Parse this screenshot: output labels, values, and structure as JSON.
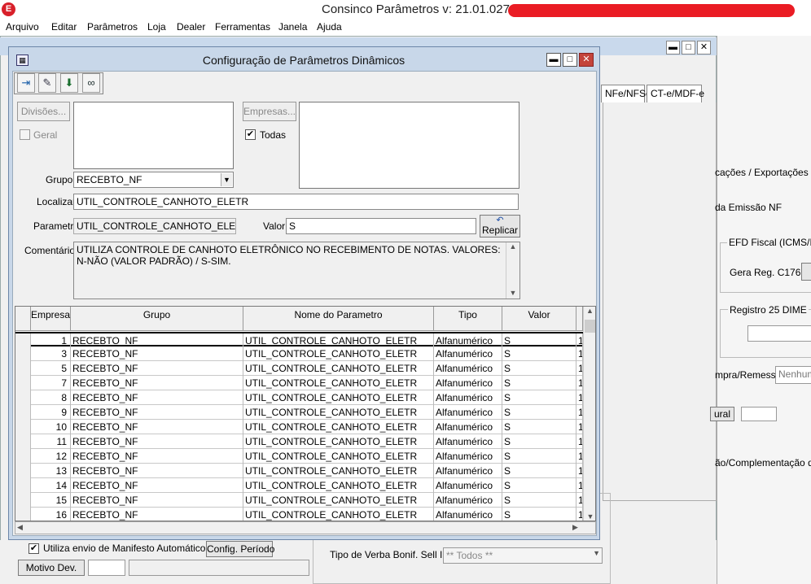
{
  "app": {
    "title": "Consinco Parâmetros  v: 21.01.027"
  },
  "menu": [
    "Arquivo",
    "Editar",
    "Parâmetros",
    "Loja",
    "Dealer",
    "Ferramentas",
    "Janela",
    "Ajuda"
  ],
  "background": {
    "tabs": [
      "NFe/NFSe",
      "CT-e/MDF-e"
    ],
    "labels": {
      "exportacoes": "cações / Exportações",
      "emissao_nf": "da Emissão NF",
      "efd_fiscal": "EFD Fiscal (ICMS/IPI",
      "gera_reg": "Gera Reg. C176",
      "registro25": "Registro 25 DIME",
      "compra_remessa": "mpra/Remessa",
      "nenhum": "Nenhum",
      "rural": "ural",
      "complementacao": "ão/Complementação de I",
      "utiliza_envio": "Utiliza envio de Manifesto Automático",
      "config_periodo": "Config. Período",
      "motivo_dev": "Motivo Dev.",
      "tipo_verba": "Tipo de Verba Bonif. Sell In",
      "tipo_verba_value": "** Todos **"
    }
  },
  "dialog": {
    "title": "Configuração de Parâmetros Dinâmicos",
    "toolbar_icons": [
      "exit-icon",
      "eraser-icon",
      "save-icon",
      "binoculars-icon"
    ],
    "divisoes_label": "Divisões...",
    "geral_label": "Geral",
    "empresas_label": "Empresas...",
    "todas_label": "Todas",
    "grupo_label": "Grupo",
    "grupo_value": "RECEBTO_NF",
    "localizar_label": "Localizar",
    "localizar_value": "UTIL_CONTROLE_CANHOTO_ELETR",
    "parametro_label": "Parametro",
    "parametro_value": "UTIL_CONTROLE_CANHOTO_ELETR",
    "valor_label": "Valor",
    "valor_value": "S",
    "replicar_label": "Replicar",
    "comentarios_label": "Comentários",
    "comentarios_value": "UTILIZA CONTROLE DE CANHOTO ELETRÔNICO NO RECEBIMENTO DE NOTAS. VALORES: N-NÃO (VALOR PADRÃO) / S-SIM."
  },
  "grid": {
    "columns": [
      "Empresa",
      "Grupo",
      "Nome do Parametro",
      "Tipo",
      "Valor"
    ],
    "rows": [
      {
        "empresa": "1",
        "grupo": "RECEBTO_NF",
        "nome": "UTIL_CONTROLE_CANHOTO_ELETR",
        "tipo": "Alfanumérico",
        "valor": "S",
        "extra": "1"
      },
      {
        "empresa": "3",
        "grupo": "RECEBTO_NF",
        "nome": "UTIL_CONTROLE_CANHOTO_ELETR",
        "tipo": "Alfanumérico",
        "valor": "S",
        "extra": "1"
      },
      {
        "empresa": "5",
        "grupo": "RECEBTO_NF",
        "nome": "UTIL_CONTROLE_CANHOTO_ELETR",
        "tipo": "Alfanumérico",
        "valor": "S",
        "extra": "1"
      },
      {
        "empresa": "7",
        "grupo": "RECEBTO_NF",
        "nome": "UTIL_CONTROLE_CANHOTO_ELETR",
        "tipo": "Alfanumérico",
        "valor": "S",
        "extra": "1"
      },
      {
        "empresa": "8",
        "grupo": "RECEBTO_NF",
        "nome": "UTIL_CONTROLE_CANHOTO_ELETR",
        "tipo": "Alfanumérico",
        "valor": "S",
        "extra": "1"
      },
      {
        "empresa": "9",
        "grupo": "RECEBTO_NF",
        "nome": "UTIL_CONTROLE_CANHOTO_ELETR",
        "tipo": "Alfanumérico",
        "valor": "S",
        "extra": "1"
      },
      {
        "empresa": "10",
        "grupo": "RECEBTO_NF",
        "nome": "UTIL_CONTROLE_CANHOTO_ELETR",
        "tipo": "Alfanumérico",
        "valor": "S",
        "extra": "1"
      },
      {
        "empresa": "11",
        "grupo": "RECEBTO_NF",
        "nome": "UTIL_CONTROLE_CANHOTO_ELETR",
        "tipo": "Alfanumérico",
        "valor": "S",
        "extra": "1"
      },
      {
        "empresa": "12",
        "grupo": "RECEBTO_NF",
        "nome": "UTIL_CONTROLE_CANHOTO_ELETR",
        "tipo": "Alfanumérico",
        "valor": "S",
        "extra": "1"
      },
      {
        "empresa": "13",
        "grupo": "RECEBTO_NF",
        "nome": "UTIL_CONTROLE_CANHOTO_ELETR",
        "tipo": "Alfanumérico",
        "valor": "S",
        "extra": "1"
      },
      {
        "empresa": "14",
        "grupo": "RECEBTO_NF",
        "nome": "UTIL_CONTROLE_CANHOTO_ELETR",
        "tipo": "Alfanumérico",
        "valor": "S",
        "extra": "1"
      },
      {
        "empresa": "15",
        "grupo": "RECEBTO_NF",
        "nome": "UTIL_CONTROLE_CANHOTO_ELETR",
        "tipo": "Alfanumérico",
        "valor": "S",
        "extra": "1"
      },
      {
        "empresa": "16",
        "grupo": "RECEBTO_NF",
        "nome": "UTIL_CONTROLE_CANHOTO_ELETR",
        "tipo": "Alfanumérico",
        "valor": "S",
        "extra": "1"
      }
    ]
  }
}
